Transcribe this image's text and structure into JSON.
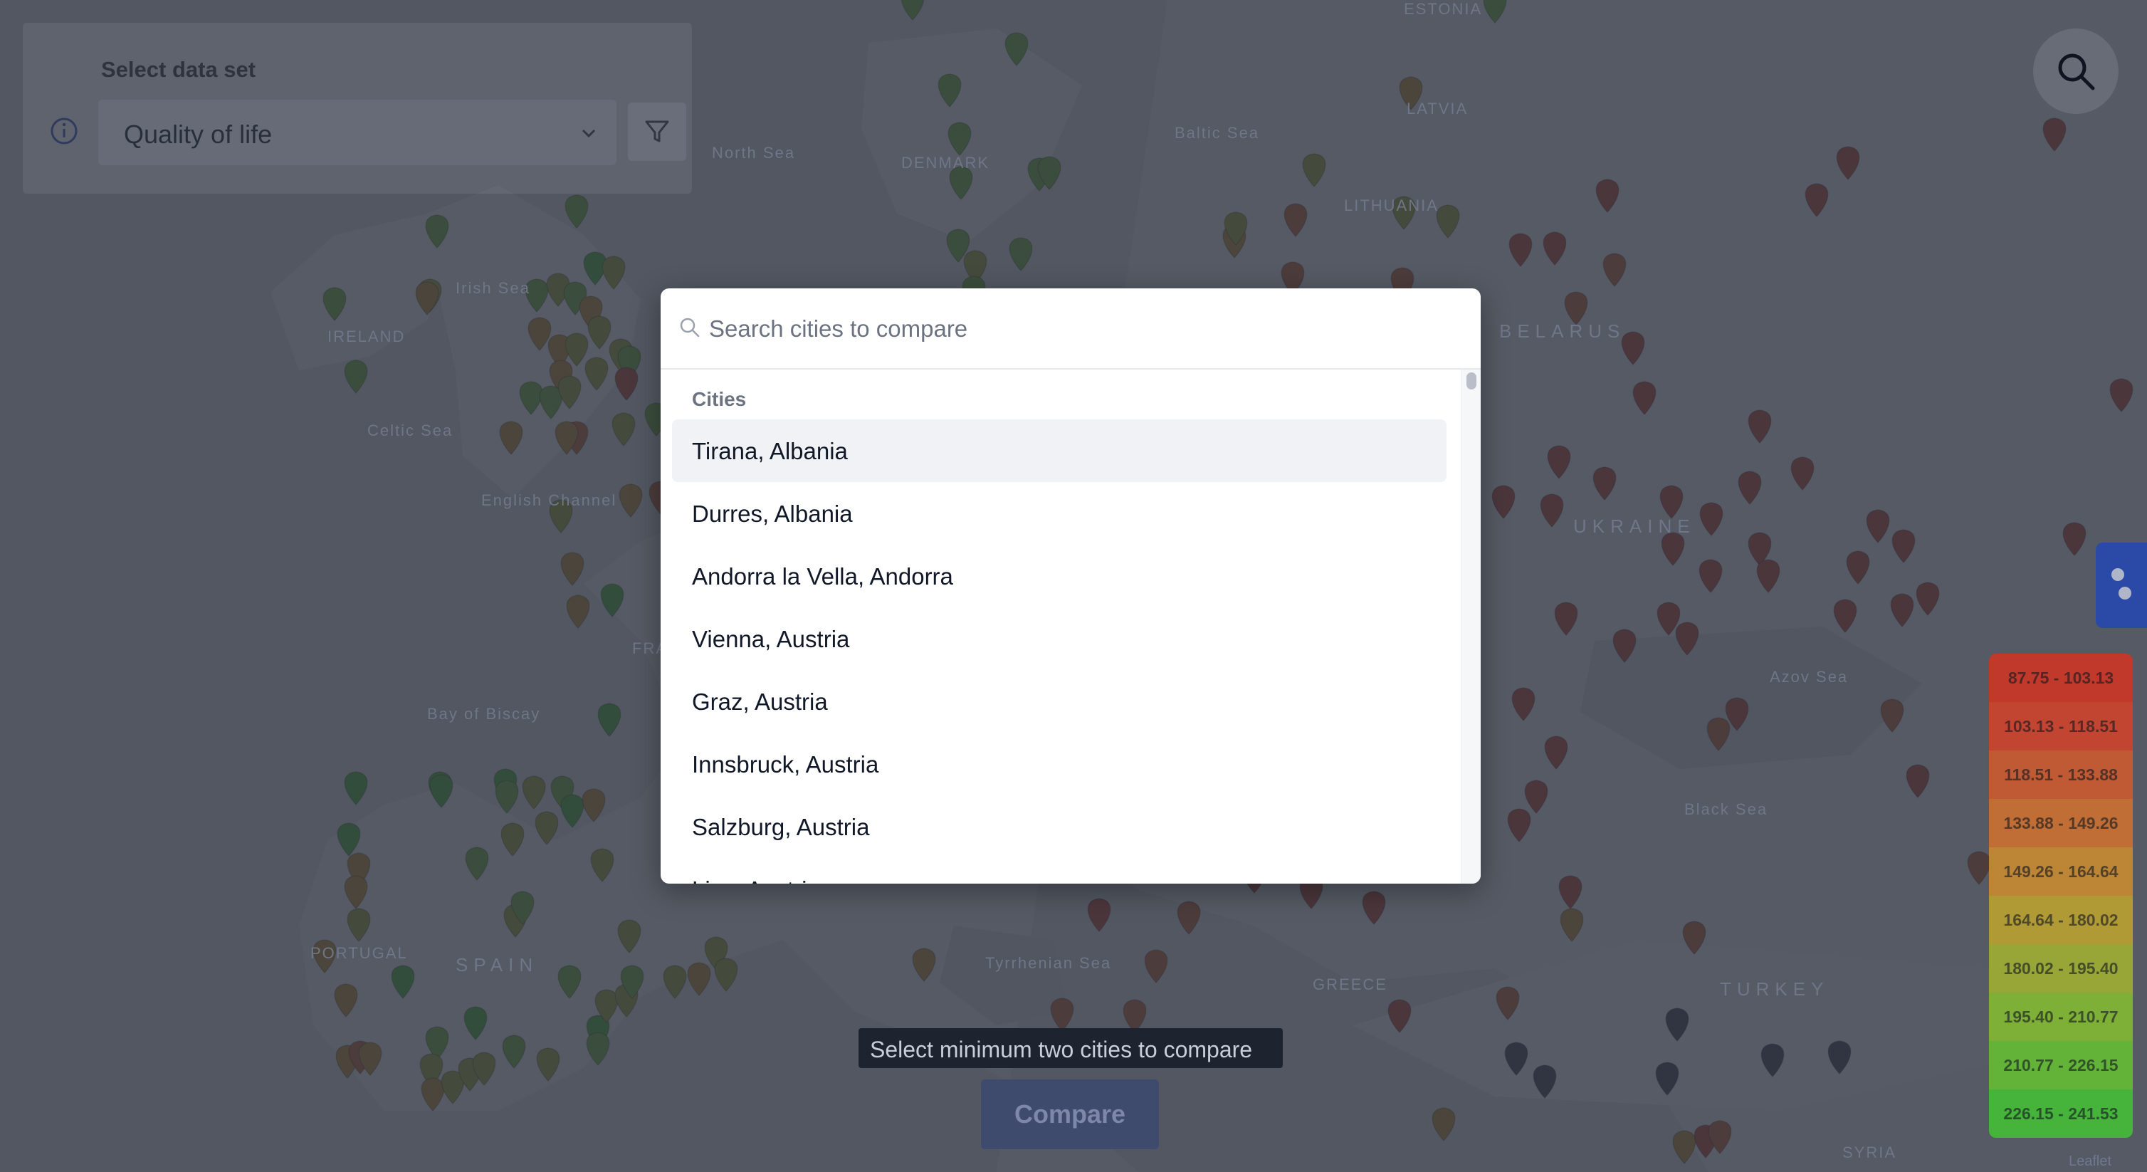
{
  "dataset_panel": {
    "label": "Select data set",
    "selected": "Quality of life"
  },
  "modal": {
    "search_placeholder": "Search cities to compare",
    "group_heading": "Cities",
    "cities": [
      "Tirana, Albania",
      "Durres, Albania",
      "Andorra la Vella, Andorra",
      "Vienna, Austria",
      "Graz, Austria",
      "Innsbruck, Austria",
      "Salzburg, Austria",
      "Linz, Austria"
    ]
  },
  "compare": {
    "tooltip": "Select minimum two cities to compare",
    "button_label": "Compare"
  },
  "legend": [
    {
      "label": "87.75 - 103.13",
      "color": "#c0392b"
    },
    {
      "label": "103.13 - 118.51",
      "color": "#c24531"
    },
    {
      "label": "118.51 - 133.88",
      "color": "#c05a34"
    },
    {
      "label": "133.88 - 149.26",
      "color": "#c06e36"
    },
    {
      "label": "149.26 - 164.64",
      "color": "#bd8536"
    },
    {
      "label": "164.64 - 180.02",
      "color": "#b09a35"
    },
    {
      "label": "180.02 - 195.40",
      "color": "#98a537"
    },
    {
      "label": "195.40 - 210.77",
      "color": "#7eaf37"
    },
    {
      "label": "210.77 - 226.15",
      "color": "#62b338"
    },
    {
      "label": "226.15 - 241.53",
      "color": "#46b43a"
    }
  ],
  "map_labels": [
    "LATVIA",
    "Baltic Sea",
    "North Sea",
    "DENMARK",
    "IRELAND",
    "Celtic Sea",
    "Irish Sea",
    "English Channel",
    "Bay of Biscay",
    "SPAIN",
    "PORTUGAL",
    "UKRAINE",
    "Black Sea",
    "Azov Sea",
    "TURKEY",
    "GREECE",
    "Tyrrhenian Sea",
    "SYRIA",
    "ESTONIA",
    "LITHUANIA",
    "FRANCE",
    "BELARUS"
  ],
  "attribution": "Leaflet",
  "colors": {
    "overlay": "#2d323e",
    "modal_bg": "#ffffff",
    "accent": "#2b4aa8"
  }
}
